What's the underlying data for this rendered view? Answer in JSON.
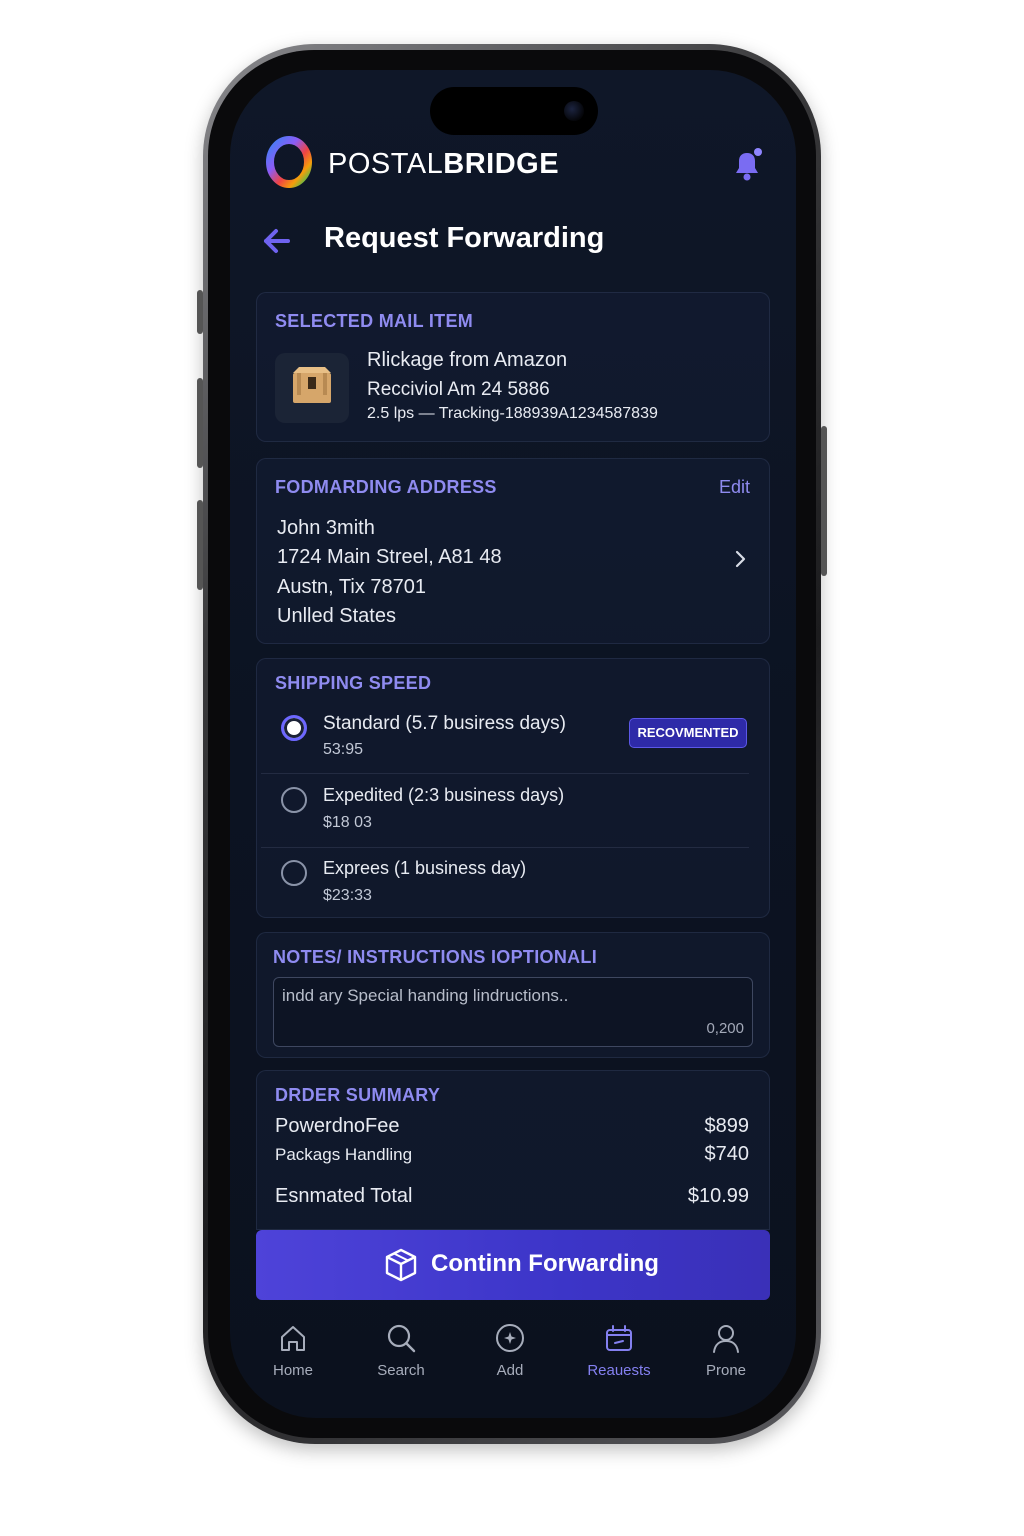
{
  "header": {
    "brand_regular": "POSTAL",
    "brand_bold": "BRIDGE",
    "notification_icon": "bell-icon"
  },
  "page": {
    "title": "Request Forwarding"
  },
  "mail_item": {
    "section_title": "SELECTED MAIL ITEM",
    "name": "Rlickage from Amazon",
    "received": "Recciviol Am 24 5886",
    "details": "2.5 lps — Tracking-188939A1234587839"
  },
  "address": {
    "section_title": "FODMARDING ADDRESS",
    "edit_label": "Edit",
    "lines": [
      "John 3mith",
      "1724 Main Streel, A81 48",
      "Austn, Tix 78701",
      "Unlled States"
    ]
  },
  "shipping": {
    "section_title": "SHIPPING SPEED",
    "badge": "RECOVMENTED",
    "options": [
      {
        "label": "Standard (5.7 busiress days)",
        "price": "53:95",
        "selected": true
      },
      {
        "label": "Expedited (2:3 business days)",
        "price": "$18 03",
        "selected": false
      },
      {
        "label": "Exprees (1 business day)",
        "price": "$23:33",
        "selected": false
      }
    ]
  },
  "notes": {
    "section_title": "NOTES/ INSTRUCTIONS IOPTIONALI",
    "placeholder": "indd ary Special handing lindructions..",
    "counter": "0,200"
  },
  "summary": {
    "section_title": "DRDER SUMMARY",
    "rows": [
      {
        "label": "PowerdnoFee",
        "value": "$899"
      },
      {
        "label": "Packags Handling",
        "value": "$740"
      }
    ],
    "total_label": "Esnmated Total",
    "total_value": "$10.99"
  },
  "cta": {
    "label": "Continn Forwarding"
  },
  "tabs": [
    {
      "label": "Home",
      "icon": "home-icon"
    },
    {
      "label": "Search",
      "icon": "search-icon"
    },
    {
      "label": "Add",
      "icon": "add-icon"
    },
    {
      "label": "Reauests",
      "icon": "requests-icon",
      "active": true
    },
    {
      "label": "Prone",
      "icon": "profile-icon"
    }
  ],
  "colors": {
    "accent": "#6d67ff",
    "section_title": "#8f8bf0",
    "background": "#0c1322",
    "cta": "#4e43d9"
  }
}
